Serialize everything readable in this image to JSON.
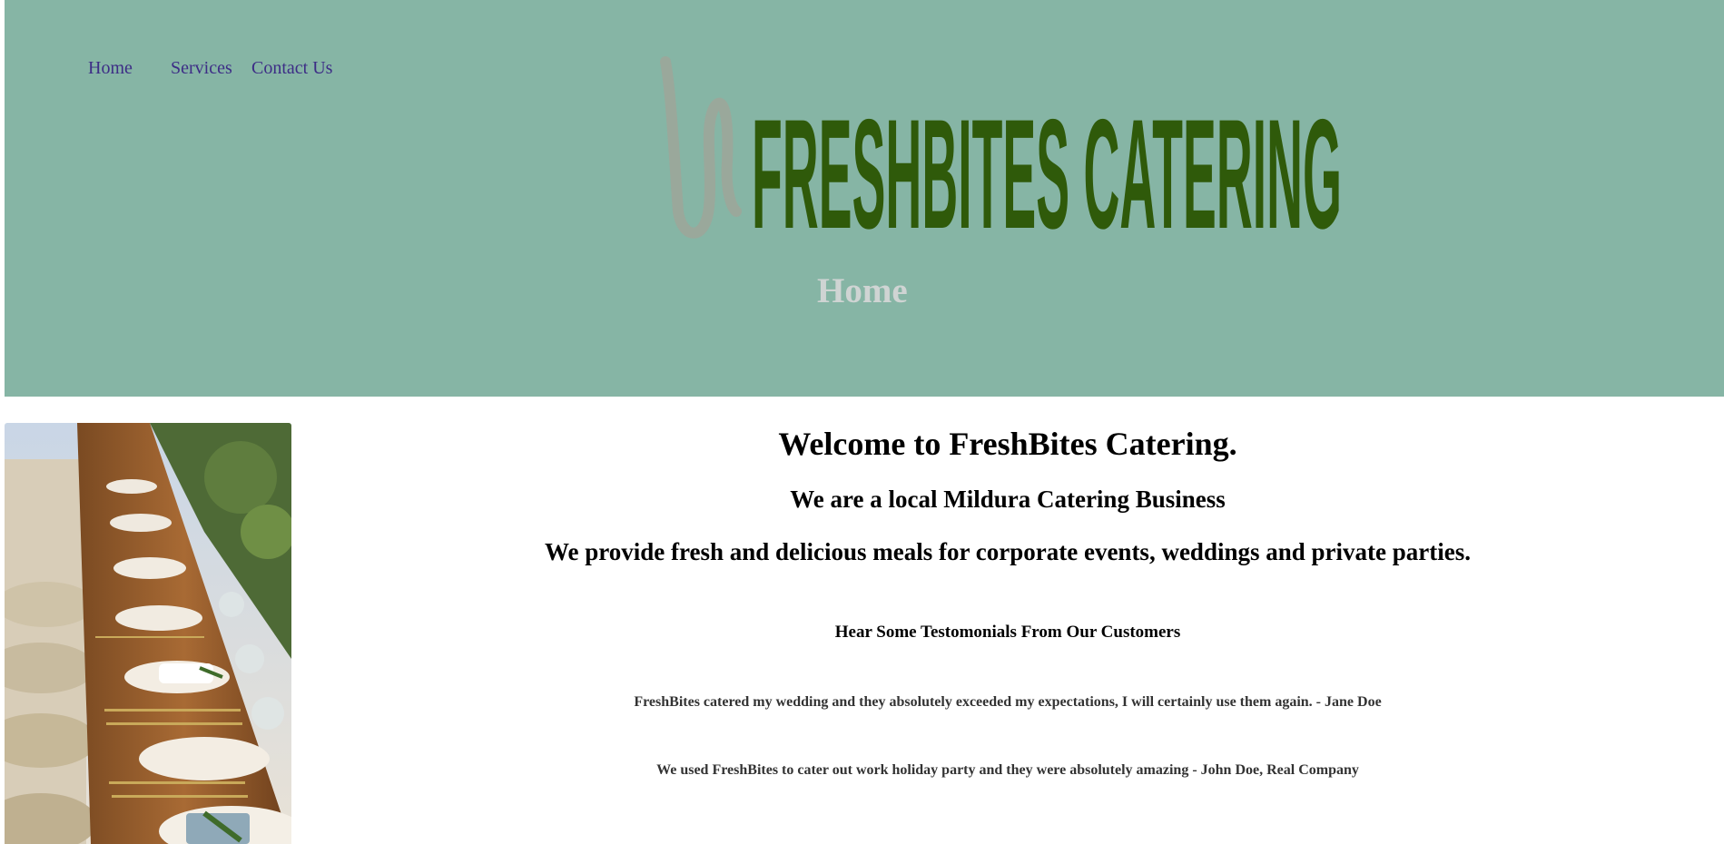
{
  "nav": {
    "items": [
      {
        "label": "Home"
      },
      {
        "label": "Services"
      },
      {
        "label": "Contact Us"
      }
    ]
  },
  "logo": {
    "text": "FRESHBITES CATERING"
  },
  "header": {
    "page_title": "Home"
  },
  "main": {
    "welcome": "Welcome to FreshBites Catering.",
    "subtitle": "We are a local Mildura Catering Business",
    "tagline": "We provide fresh and delicious meals for corporate events, weddings and private parties.",
    "testimonials_heading": "Hear Some Testomonials From Our Customers",
    "testimonials": [
      {
        "text": "FreshBites catered my wedding and they absolutely exceeded my expectations, I will certainly use them again. - Jane Doe"
      },
      {
        "text": "We used FreshBites to cater out work holiday party and they were absolutely amazing - John Doe, Real Company"
      }
    ]
  },
  "colors": {
    "header_bg": "#86b5a5",
    "nav_link": "#3d2d86",
    "logo_text": "#2f5a0a",
    "logo_mark": "#9aa89b",
    "page_title": "#cfd4d3"
  }
}
